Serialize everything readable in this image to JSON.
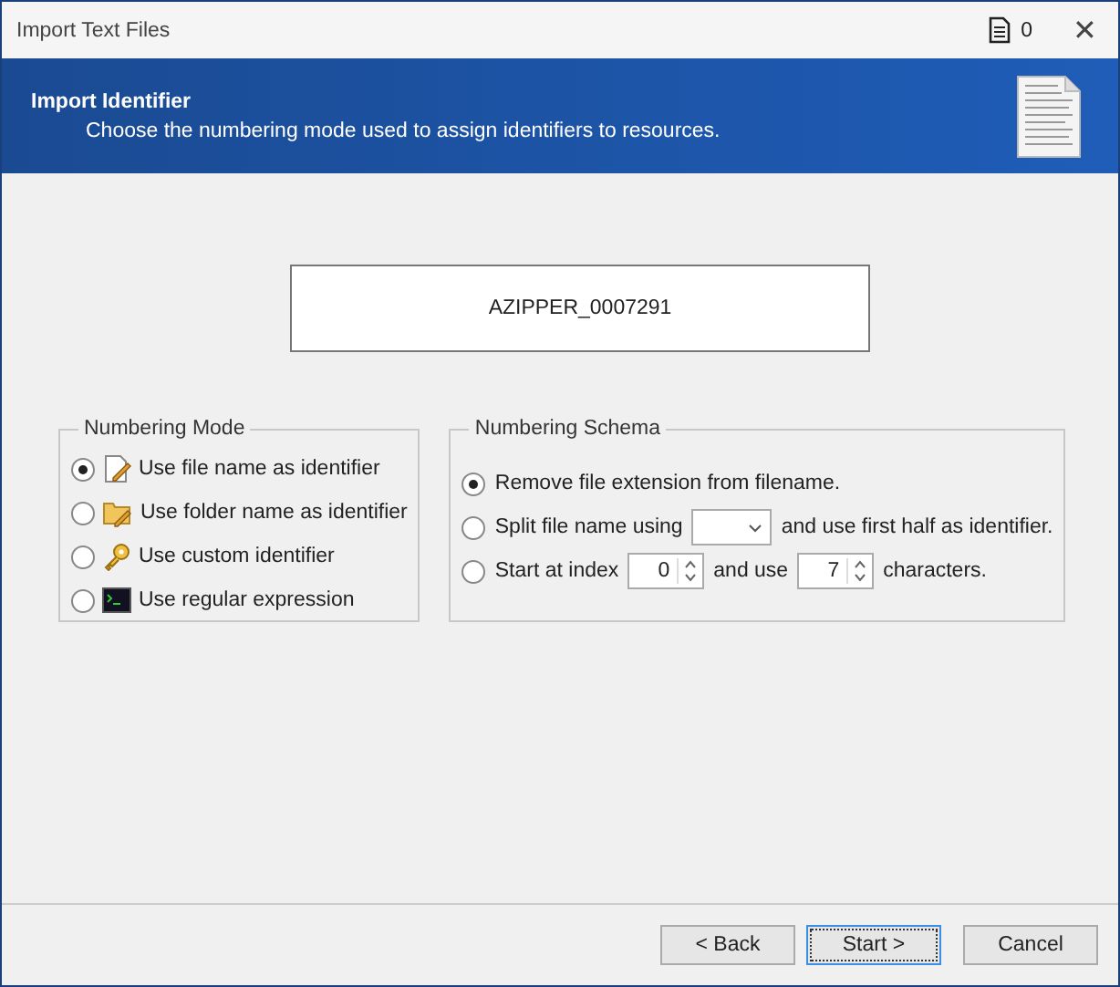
{
  "window": {
    "title": "Import Text Files",
    "doc_count": "0",
    "close": "✕"
  },
  "header": {
    "title": "Import Identifier",
    "subtitle": "Choose the numbering mode used to assign identifiers to resources."
  },
  "preview": "AZIPPER_0007291",
  "numbering_mode": {
    "title": "Numbering Mode",
    "options": [
      {
        "label": "Use file name as identifier",
        "kind": "file",
        "selected": true
      },
      {
        "label": "Use folder name as identifier",
        "kind": "folder",
        "selected": false
      },
      {
        "label": "Use custom identifier",
        "kind": "key",
        "selected": false
      },
      {
        "label": "Use regular expression",
        "kind": "terminal",
        "selected": false
      }
    ]
  },
  "numbering_schema": {
    "title": "Numbering Schema",
    "options": [
      {
        "selected": true,
        "parts": [
          {
            "kind": "text",
            "text": "Remove file extension from filename."
          }
        ]
      },
      {
        "selected": false,
        "parts": [
          {
            "kind": "text",
            "text": "Split file name using"
          },
          {
            "kind": "dropdown"
          },
          {
            "kind": "text",
            "text": "and use first half as identifier."
          }
        ]
      },
      {
        "selected": false,
        "parts": [
          {
            "kind": "text",
            "text": "Start at index"
          },
          {
            "kind": "spinner",
            "value": "0"
          },
          {
            "kind": "text",
            "text": "and use"
          },
          {
            "kind": "spinner",
            "value": "7"
          },
          {
            "kind": "text",
            "text": "characters."
          }
        ]
      }
    ]
  },
  "buttons": [
    {
      "label": "< Back",
      "focused": false
    },
    {
      "label": "Start >",
      "focused": true
    },
    {
      "label": "Cancel",
      "focused": false
    }
  ]
}
